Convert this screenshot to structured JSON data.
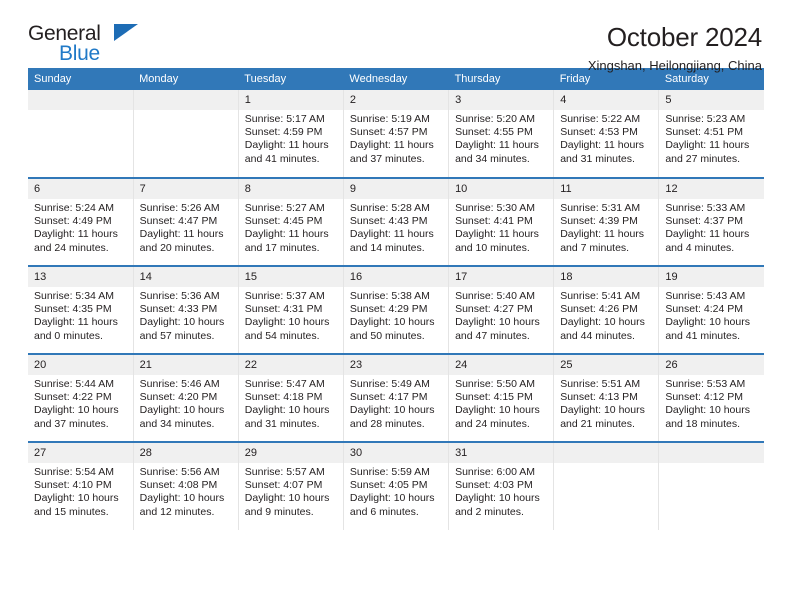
{
  "brand": {
    "name_top": "General",
    "name_bottom": "Blue",
    "accent_color": "#2079c7",
    "triangle_color": "#1d6cb5"
  },
  "header": {
    "title": "October 2024",
    "subtitle": "Xingshan, Heilongjiang, China"
  },
  "calendar": {
    "header_bg": "#3178b8",
    "daynum_bg": "#f0f0f0",
    "weekday_headers": [
      "Sunday",
      "Monday",
      "Tuesday",
      "Wednesday",
      "Thursday",
      "Friday",
      "Saturday"
    ],
    "weeks": [
      [
        {
          "day": "",
          "sunrise": "",
          "sunset": "",
          "daylight": ""
        },
        {
          "day": "",
          "sunrise": "",
          "sunset": "",
          "daylight": ""
        },
        {
          "day": "1",
          "sunrise": "Sunrise: 5:17 AM",
          "sunset": "Sunset: 4:59 PM",
          "daylight": "Daylight: 11 hours and 41 minutes."
        },
        {
          "day": "2",
          "sunrise": "Sunrise: 5:19 AM",
          "sunset": "Sunset: 4:57 PM",
          "daylight": "Daylight: 11 hours and 37 minutes."
        },
        {
          "day": "3",
          "sunrise": "Sunrise: 5:20 AM",
          "sunset": "Sunset: 4:55 PM",
          "daylight": "Daylight: 11 hours and 34 minutes."
        },
        {
          "day": "4",
          "sunrise": "Sunrise: 5:22 AM",
          "sunset": "Sunset: 4:53 PM",
          "daylight": "Daylight: 11 hours and 31 minutes."
        },
        {
          "day": "5",
          "sunrise": "Sunrise: 5:23 AM",
          "sunset": "Sunset: 4:51 PM",
          "daylight": "Daylight: 11 hours and 27 minutes."
        }
      ],
      [
        {
          "day": "6",
          "sunrise": "Sunrise: 5:24 AM",
          "sunset": "Sunset: 4:49 PM",
          "daylight": "Daylight: 11 hours and 24 minutes."
        },
        {
          "day": "7",
          "sunrise": "Sunrise: 5:26 AM",
          "sunset": "Sunset: 4:47 PM",
          "daylight": "Daylight: 11 hours and 20 minutes."
        },
        {
          "day": "8",
          "sunrise": "Sunrise: 5:27 AM",
          "sunset": "Sunset: 4:45 PM",
          "daylight": "Daylight: 11 hours and 17 minutes."
        },
        {
          "day": "9",
          "sunrise": "Sunrise: 5:28 AM",
          "sunset": "Sunset: 4:43 PM",
          "daylight": "Daylight: 11 hours and 14 minutes."
        },
        {
          "day": "10",
          "sunrise": "Sunrise: 5:30 AM",
          "sunset": "Sunset: 4:41 PM",
          "daylight": "Daylight: 11 hours and 10 minutes."
        },
        {
          "day": "11",
          "sunrise": "Sunrise: 5:31 AM",
          "sunset": "Sunset: 4:39 PM",
          "daylight": "Daylight: 11 hours and 7 minutes."
        },
        {
          "day": "12",
          "sunrise": "Sunrise: 5:33 AM",
          "sunset": "Sunset: 4:37 PM",
          "daylight": "Daylight: 11 hours and 4 minutes."
        }
      ],
      [
        {
          "day": "13",
          "sunrise": "Sunrise: 5:34 AM",
          "sunset": "Sunset: 4:35 PM",
          "daylight": "Daylight: 11 hours and 0 minutes."
        },
        {
          "day": "14",
          "sunrise": "Sunrise: 5:36 AM",
          "sunset": "Sunset: 4:33 PM",
          "daylight": "Daylight: 10 hours and 57 minutes."
        },
        {
          "day": "15",
          "sunrise": "Sunrise: 5:37 AM",
          "sunset": "Sunset: 4:31 PM",
          "daylight": "Daylight: 10 hours and 54 minutes."
        },
        {
          "day": "16",
          "sunrise": "Sunrise: 5:38 AM",
          "sunset": "Sunset: 4:29 PM",
          "daylight": "Daylight: 10 hours and 50 minutes."
        },
        {
          "day": "17",
          "sunrise": "Sunrise: 5:40 AM",
          "sunset": "Sunset: 4:27 PM",
          "daylight": "Daylight: 10 hours and 47 minutes."
        },
        {
          "day": "18",
          "sunrise": "Sunrise: 5:41 AM",
          "sunset": "Sunset: 4:26 PM",
          "daylight": "Daylight: 10 hours and 44 minutes."
        },
        {
          "day": "19",
          "sunrise": "Sunrise: 5:43 AM",
          "sunset": "Sunset: 4:24 PM",
          "daylight": "Daylight: 10 hours and 41 minutes."
        }
      ],
      [
        {
          "day": "20",
          "sunrise": "Sunrise: 5:44 AM",
          "sunset": "Sunset: 4:22 PM",
          "daylight": "Daylight: 10 hours and 37 minutes."
        },
        {
          "day": "21",
          "sunrise": "Sunrise: 5:46 AM",
          "sunset": "Sunset: 4:20 PM",
          "daylight": "Daylight: 10 hours and 34 minutes."
        },
        {
          "day": "22",
          "sunrise": "Sunrise: 5:47 AM",
          "sunset": "Sunset: 4:18 PM",
          "daylight": "Daylight: 10 hours and 31 minutes."
        },
        {
          "day": "23",
          "sunrise": "Sunrise: 5:49 AM",
          "sunset": "Sunset: 4:17 PM",
          "daylight": "Daylight: 10 hours and 28 minutes."
        },
        {
          "day": "24",
          "sunrise": "Sunrise: 5:50 AM",
          "sunset": "Sunset: 4:15 PM",
          "daylight": "Daylight: 10 hours and 24 minutes."
        },
        {
          "day": "25",
          "sunrise": "Sunrise: 5:51 AM",
          "sunset": "Sunset: 4:13 PM",
          "daylight": "Daylight: 10 hours and 21 minutes."
        },
        {
          "day": "26",
          "sunrise": "Sunrise: 5:53 AM",
          "sunset": "Sunset: 4:12 PM",
          "daylight": "Daylight: 10 hours and 18 minutes."
        }
      ],
      [
        {
          "day": "27",
          "sunrise": "Sunrise: 5:54 AM",
          "sunset": "Sunset: 4:10 PM",
          "daylight": "Daylight: 10 hours and 15 minutes."
        },
        {
          "day": "28",
          "sunrise": "Sunrise: 5:56 AM",
          "sunset": "Sunset: 4:08 PM",
          "daylight": "Daylight: 10 hours and 12 minutes."
        },
        {
          "day": "29",
          "sunrise": "Sunrise: 5:57 AM",
          "sunset": "Sunset: 4:07 PM",
          "daylight": "Daylight: 10 hours and 9 minutes."
        },
        {
          "day": "30",
          "sunrise": "Sunrise: 5:59 AM",
          "sunset": "Sunset: 4:05 PM",
          "daylight": "Daylight: 10 hours and 6 minutes."
        },
        {
          "day": "31",
          "sunrise": "Sunrise: 6:00 AM",
          "sunset": "Sunset: 4:03 PM",
          "daylight": "Daylight: 10 hours and 2 minutes."
        },
        {
          "day": "",
          "sunrise": "",
          "sunset": "",
          "daylight": ""
        },
        {
          "day": "",
          "sunrise": "",
          "sunset": "",
          "daylight": ""
        }
      ]
    ]
  }
}
